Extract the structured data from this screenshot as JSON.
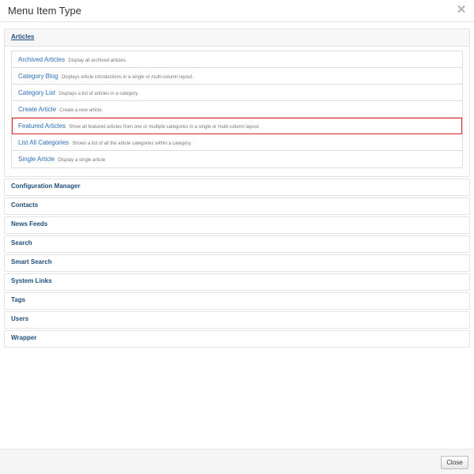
{
  "modal": {
    "title": "Menu Item Type",
    "close_icon": "close-icon"
  },
  "accordion": {
    "articles": {
      "label": "Articles",
      "items": [
        {
          "title": "Archived Articles",
          "desc": "Display all archived articles."
        },
        {
          "title": "Category Blog",
          "desc": "Displays article introductions in a single or multi-column layout."
        },
        {
          "title": "Category List",
          "desc": "Displays a list of articles in a category."
        },
        {
          "title": "Create Article",
          "desc": "Create a new article."
        },
        {
          "title": "Featured Articles",
          "desc": "Show all featured articles from one or multiple categories in a single or multi-column layout."
        },
        {
          "title": "List All Categories",
          "desc": "Shows a list of all the article categories within a category."
        },
        {
          "title": "Single Article",
          "desc": "Display a single article"
        }
      ]
    },
    "groups": [
      "Configuration Manager",
      "Contacts",
      "News Feeds",
      "Search",
      "Smart Search",
      "System Links",
      "Tags",
      "Users",
      "Wrapper"
    ]
  },
  "footer": {
    "close_label": "Close"
  },
  "colors": {
    "link": "#2a6eb6",
    "heading": "#1f4e79",
    "highlight": "#e02020"
  }
}
